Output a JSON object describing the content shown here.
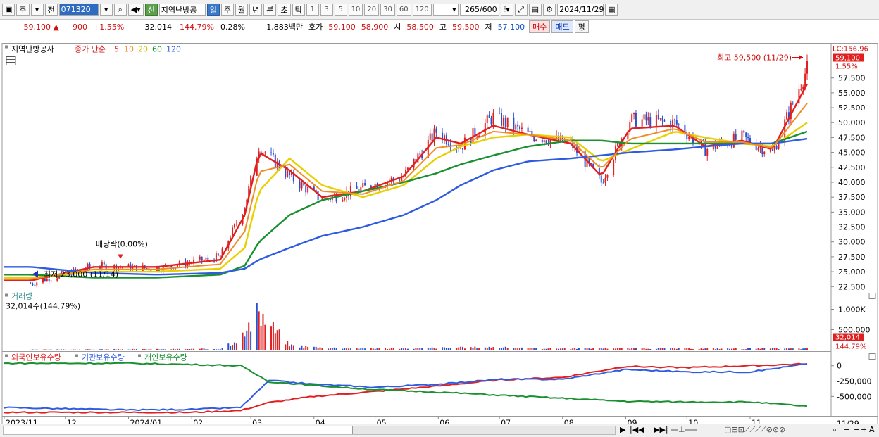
{
  "toolbar": {
    "cycle": "주",
    "prev": "전",
    "code": "071320",
    "badge": "신",
    "name": "지역난방공",
    "periods": [
      "일",
      "주",
      "월",
      "년",
      "분",
      "초",
      "틱"
    ],
    "minutes": [
      "1",
      "3",
      "5",
      "10",
      "20",
      "30",
      "60",
      "120"
    ],
    "count": "265",
    "count_total": "/600",
    "date": "2024/11/29"
  },
  "quote": {
    "price": "59,100",
    "arrow": "▲",
    "change": "900",
    "rate": "+1.55%",
    "volume": "32,014",
    "vol_ratio": "144.79%",
    "turnover_rate": "0.28%",
    "amount": "1,883백만",
    "ask_label": "호가",
    "ask1": "59,100",
    "ask2": "58,900",
    "open_label": "시",
    "open": "58,500",
    "high_label": "고",
    "high": "59,500",
    "low_label": "저",
    "low": "57,100",
    "buy": "매수",
    "sell": "매도",
    "eval": "평"
  },
  "price_panel": {
    "name_tag": "지역난방공사",
    "legend_prefix": "종가 단순",
    "ma_labels": [
      "5",
      "10",
      "20",
      "60",
      "120"
    ],
    "ma_colors": [
      "#e02020",
      "#f08c28",
      "#e8d000",
      "#1a9030",
      "#2e5ce0"
    ],
    "lc_label": "LC:156.96",
    "price_box": "59,100",
    "pct_box": "1.55%",
    "y_ticks": [
      "57,500",
      "55,000",
      "52,500",
      "50,000",
      "47,500",
      "45,000",
      "42,500",
      "40,000",
      "37,500",
      "35,000",
      "32,500",
      "30,000",
      "27,500",
      "25,000",
      "22,500"
    ],
    "high_annotation": "최고 59,500 (11/29)",
    "low_annotation": "최저 23,000 (11/14)",
    "dividend_annotation": "배당락(0.00%)"
  },
  "volume_panel": {
    "title": "거래량",
    "current": "32,014주(144.79%)",
    "y_ticks": [
      "1,000K",
      "500,000"
    ],
    "value_box": "32,014",
    "pct_box": "144.79%"
  },
  "holding_panel": {
    "legends": [
      "외국인보유수량",
      "기관보유수량",
      "개인보유수량"
    ],
    "colors": [
      "#e02020",
      "#2e5ce0",
      "#1a9030"
    ],
    "y_ticks": [
      "0",
      "-250,000",
      "-500,000"
    ]
  },
  "x_axis": {
    "labels": [
      "2023/11",
      "12",
      "2024/01",
      "02",
      "03",
      "04",
      "05",
      "06",
      "07",
      "08",
      "09",
      "10",
      "11"
    ],
    "end_label": "11/29"
  },
  "chart_data": {
    "type": "line",
    "x": [
      "2023-11-14",
      "2023-12-15",
      "2024-01-15",
      "2024-02-15",
      "2024-02-27",
      "2024-03-05",
      "2024-03-20",
      "2024-04-05",
      "2024-04-25",
      "2024-05-15",
      "2024-05-31",
      "2024-06-12",
      "2024-06-28",
      "2024-07-15",
      "2024-08-05",
      "2024-08-20",
      "2024-09-03",
      "2024-09-25",
      "2024-10-10",
      "2024-10-28",
      "2024-11-12",
      "2024-11-29"
    ],
    "series": [
      {
        "name": "종가",
        "values": [
          23000,
          26000,
          25500,
          27500,
          36000,
          46000,
          41000,
          37000,
          39000,
          41000,
          48500,
          46000,
          51000,
          48000,
          46500,
          40000,
          50500,
          50000,
          45500,
          47500,
          45000,
          59100
        ]
      },
      {
        "name": "5",
        "values": [
          23500,
          25800,
          25800,
          27000,
          34500,
          45000,
          42000,
          37500,
          38500,
          41000,
          47500,
          46500,
          49500,
          48000,
          46500,
          41000,
          49000,
          49500,
          46000,
          47000,
          45500,
          56500
        ]
      },
      {
        "name": "20",
        "values": [
          24000,
          25000,
          25000,
          25500,
          29000,
          38500,
          44000,
          39500,
          37500,
          39500,
          44000,
          46000,
          47500,
          48000,
          47500,
          43500,
          45500,
          48500,
          47500,
          46500,
          46000,
          50000
        ]
      },
      {
        "name": "60",
        "values": [
          24500,
          24000,
          24000,
          24500,
          26000,
          30000,
          34500,
          37000,
          38500,
          40000,
          41500,
          43000,
          44500,
          46000,
          47000,
          47000,
          46500,
          46500,
          46500,
          46500,
          46500,
          48500
        ]
      },
      {
        "name": "120",
        "values": [
          25800,
          24800,
          24500,
          24800,
          25500,
          27000,
          29000,
          31000,
          32500,
          34500,
          37000,
          39500,
          42000,
          43500,
          44000,
          44500,
          45000,
          45500,
          46000,
          46500,
          46500,
          47300
        ]
      }
    ],
    "volume": [
      12,
      18,
      22,
      30,
      380,
      900,
      120,
      60,
      45,
      40,
      55,
      60,
      70,
      45,
      40,
      50,
      45,
      40,
      35,
      38,
      40,
      32
    ],
    "holdings": {
      "x": [
        "2023-11",
        "2024-01",
        "2024-02",
        "2024-02-25",
        "2024-03-10",
        "2024-04",
        "2024-05",
        "2024-06",
        "2024-07",
        "2024-08",
        "2024-09",
        "2024-10",
        "2024-11",
        "2024-11-29"
      ],
      "foreign": [
        -760000,
        -760000,
        -760000,
        -730000,
        -600000,
        -500000,
        -420000,
        -330000,
        -230000,
        -190000,
        -10000,
        -30000,
        0,
        30000
      ],
      "institution": [
        -680000,
        -720000,
        -710000,
        -680000,
        -240000,
        -300000,
        -350000,
        -300000,
        -220000,
        -220000,
        -60000,
        -100000,
        -100000,
        30000
      ],
      "individual": [
        40000,
        40000,
        20000,
        0,
        -260000,
        -320000,
        -390000,
        -430000,
        -480000,
        -530000,
        -580000,
        -590000,
        -590000,
        -660000
      ]
    },
    "ylim": [
      22000,
      60000
    ]
  }
}
